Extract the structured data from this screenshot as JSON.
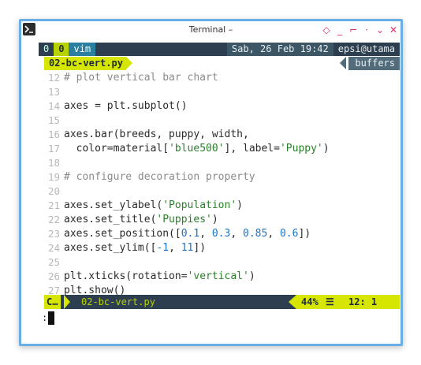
{
  "window": {
    "title": "Terminal –",
    "controls": [
      "◇",
      "_",
      "⌐",
      "·",
      "⌄",
      "✕"
    ]
  },
  "statusline": {
    "win0": "0",
    "win1": "0",
    "session": "vim",
    "datetime": "Sab, 26 Feb 19:42",
    "host": "epsi@utama"
  },
  "tabline": {
    "active_file": "02-bc-vert.py",
    "buffers_label": "buffers"
  },
  "editor": {
    "lines": [
      {
        "n": "12",
        "t": "# plot vertical bar chart"
      },
      {
        "n": "13",
        "t": ""
      },
      {
        "n": "14",
        "t": "axes = plt.subplot()"
      },
      {
        "n": "15",
        "t": ""
      },
      {
        "n": "16",
        "t": "axes.bar(breeds, puppy, width,"
      },
      {
        "n": "17",
        "t": "  color=material['blue500'], label='Puppy')"
      },
      {
        "n": "18",
        "t": ""
      },
      {
        "n": "19",
        "t": "# configure decoration property"
      },
      {
        "n": "20",
        "t": ""
      },
      {
        "n": "21",
        "t": "axes.set_ylabel('Population')"
      },
      {
        "n": "22",
        "t": "axes.set_title('Puppies')"
      },
      {
        "n": "23",
        "t": "axes.set_position([0.1, 0.3, 0.85, 0.6])"
      },
      {
        "n": "24",
        "t": "axes.set_ylim([-1, 11])"
      },
      {
        "n": "25",
        "t": ""
      },
      {
        "n": "26",
        "t": "plt.xticks(rotation='vertical')"
      },
      {
        "n": "27",
        "t": "plt.show()"
      }
    ]
  },
  "bottombar": {
    "mode": "C…",
    "filename": "02-bc-vert.py",
    "percent": "44%",
    "lines_icon": "☰",
    "position": "12:  1"
  },
  "cmdline": {
    "prompt": ":"
  }
}
